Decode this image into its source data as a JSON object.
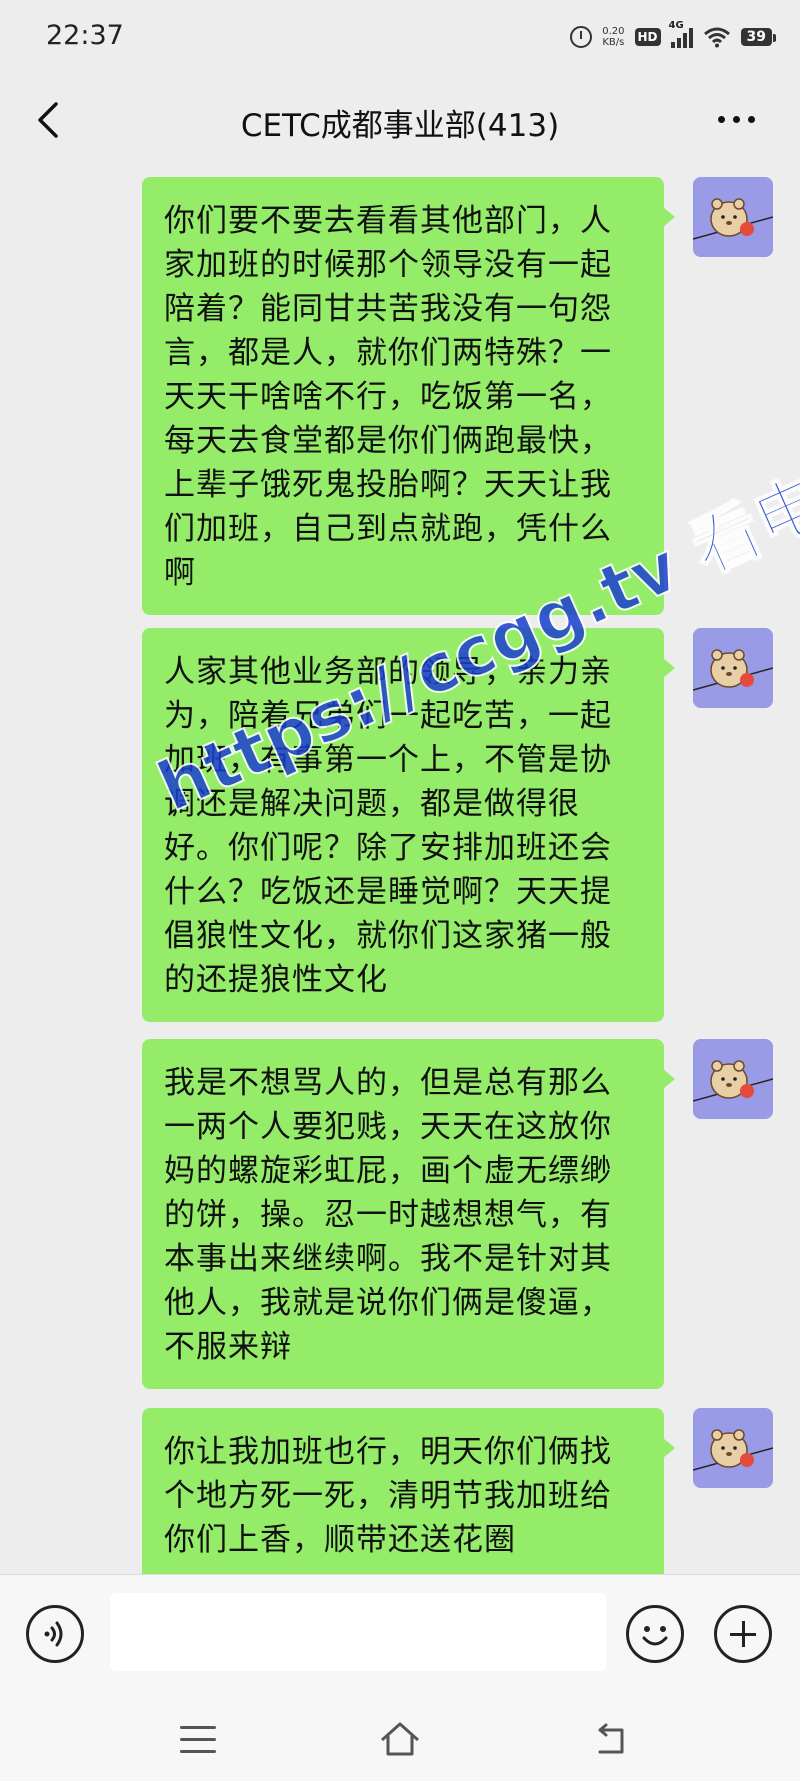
{
  "status_bar": {
    "time": "22:37",
    "net_speed_value": "0.20",
    "net_speed_unit": "KB/s",
    "hd_badge": "HD",
    "network": "4G",
    "battery": "39",
    "icons": [
      "alarm-icon",
      "hd-icon",
      "signal-icon",
      "wifi-icon",
      "battery-icon"
    ]
  },
  "header": {
    "title": "CETC成都事业部(413)",
    "back_icon": "chevron-left-icon",
    "more_icon": "more-dots-icon"
  },
  "messages": [
    {
      "sender": "self",
      "text": "你们要不要去看看其他部门，人家加班的时候那个领导没有一起陪着？能同甘共苦我没有一句怨言，都是人，就你们两特殊？一天天干啥啥不行，吃饭第一名，每天去食堂都是你们俩跑最快，上辈子饿死鬼投胎啊？天天让我们加班，自己到点就跑，凭什么啊"
    },
    {
      "sender": "self",
      "text": "人家其他业务部的领导，亲力亲为，陪着兄弟们一起吃苦，一起加班，有事第一个上，不管是协调还是解决问题，都是做得很好。你们呢？除了安排加班还会什么？吃饭还是睡觉啊？天天提倡狼性文化，就你们这家猪一般的还提狼性文化"
    },
    {
      "sender": "self",
      "text": "我是不想骂人的，但是总有那么一两个人要犯贱，天天在这放你妈的螺旋彩虹屁，画个虚无缥缈的饼，操。忍一时越想想气，有本事出来继续啊。我不是针对其他人，我就是说你们俩是傻逼，不服来辩"
    },
    {
      "sender": "self",
      "text": "你让我加班也行，明天你们俩找个地方死一死，清明节我加班给你们上香，顺带还送花圈"
    }
  ],
  "watermark": "https://ccgg.tv 看电报",
  "input_bar": {
    "placeholder": "",
    "voice_icon": "voice-icon",
    "emoji_icon": "emoji-icon",
    "plus_icon": "plus-icon"
  },
  "nav_bar": {
    "icons": [
      "menu-icon",
      "home-icon",
      "back-icon"
    ]
  },
  "colors": {
    "background": "#ededed",
    "bubble_self": "#95ec69",
    "avatar_bg": "#9a9be6",
    "watermark": "#1a3fd0"
  }
}
